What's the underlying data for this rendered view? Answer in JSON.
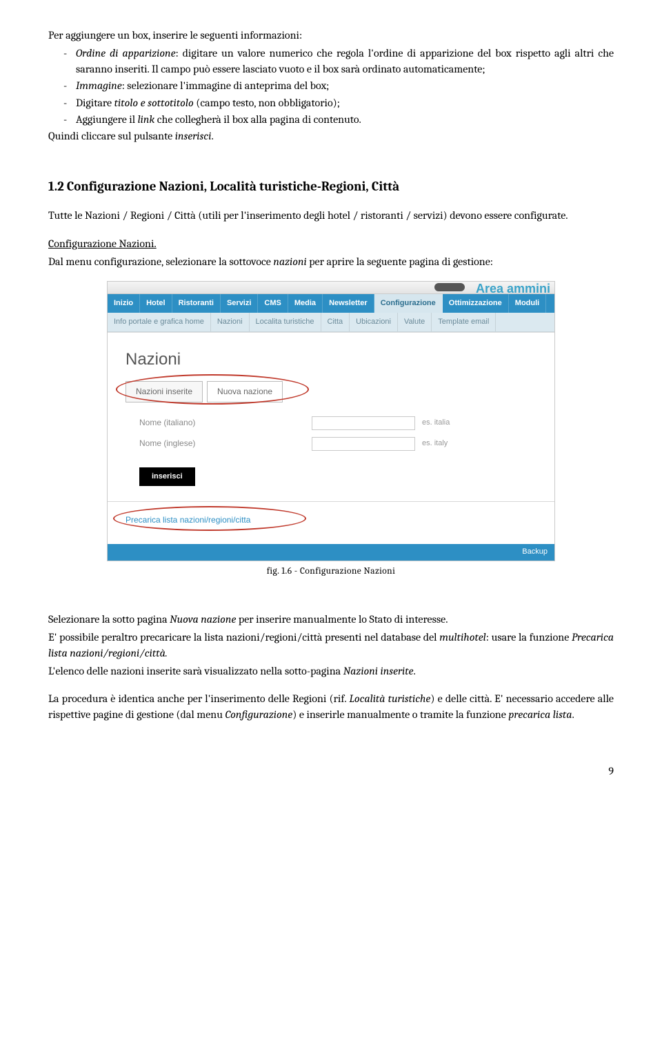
{
  "intro": {
    "lead": "Per aggiungere un box, inserire le seguenti informazioni:",
    "b1a": "Ordine di apparizione",
    "b1b": ": digitare un valore numerico che regola l'ordine di apparizione del box rispetto agli altri che saranno inseriti. Il campo può essere lasciato vuoto e il box sarà ordinato automaticamente;",
    "b2a": "Immagine",
    "b2b": ": selezionare l'immagine di anteprima del box;",
    "b3a": "Digitare ",
    "b3b": "titolo e sottotitolo",
    "b3c": " (campo testo, non obbligatorio);",
    "b4a": "Aggiungere il ",
    "b4b": "link",
    "b4c": " che collegherà il box alla pagina di contenuto.",
    "tail1": "Quindi cliccare sul pulsante ",
    "tail2": "inserisci",
    "tail3": "."
  },
  "heading": "1.2 Configurazione Nazioni, Località turistiche-Regioni, Città",
  "para1": "Tutte le Nazioni / Regioni / Città (utili per l'inserimento degli hotel / ristoranti / servizi) devono essere configurate.",
  "conf_title": "Configurazione Nazioni.",
  "conf_p1a": "Dal menu configurazione, selezionare la sottovoce ",
  "conf_p1b": "nazioni",
  "conf_p1c": " per aprire la seguente pagina di gestione:",
  "app": {
    "area": "Area ammini",
    "nav1": [
      "Inizio",
      "Hotel",
      "Ristoranti",
      "Servizi",
      "CMS",
      "Media",
      "Newsletter",
      "Configurazione",
      "Ottimizzazione",
      "Moduli"
    ],
    "nav2": [
      "Info portale e grafica home",
      "Nazioni",
      "Localita turistiche",
      "Citta",
      "Ubicazioni",
      "Valute",
      "Template email"
    ],
    "panel_title": "Nazioni",
    "subtabs": [
      "Nazioni inserite",
      "Nuova nazione"
    ],
    "row1_label": "Nome (italiano)",
    "row1_hint": "es. italia",
    "row2_label": "Nome (inglese)",
    "row2_hint": "es. italy",
    "btn": "inserisci",
    "prelink": "Precarica lista nazioni/regioni/citta",
    "backup": "Backup"
  },
  "caption": "fig. 1.6 - Configurazione Nazioni",
  "post": {
    "p1a": "Selezionare la sotto pagina ",
    "p1b": "Nuova nazione",
    "p1c": " per inserire manualmente lo Stato di interesse.",
    "p2a": "E' possibile peraltro precaricare la lista nazioni/regioni/città presenti nel database del ",
    "p2b": "multihotel",
    "p2c": ": usare la funzione ",
    "p2d": "Precarica lista nazioni/regioni/città.",
    "p3a": "L'elenco delle nazioni inserite sarà visualizzato nella sotto-pagina ",
    "p3b": "Nazioni inserite",
    "p3c": ".",
    "p4a": "La procedura è identica anche per l'inserimento delle Regioni (rif. ",
    "p4b": "Località turistiche",
    "p4c": ") e delle città. E' necessario accedere alle rispettive pagine di gestione (dal menu ",
    "p4d": "Configurazione",
    "p4e": ") e inserirle manualmente o tramite la funzione ",
    "p4f": "precarica lista",
    "p4g": "."
  },
  "page_number": "9"
}
